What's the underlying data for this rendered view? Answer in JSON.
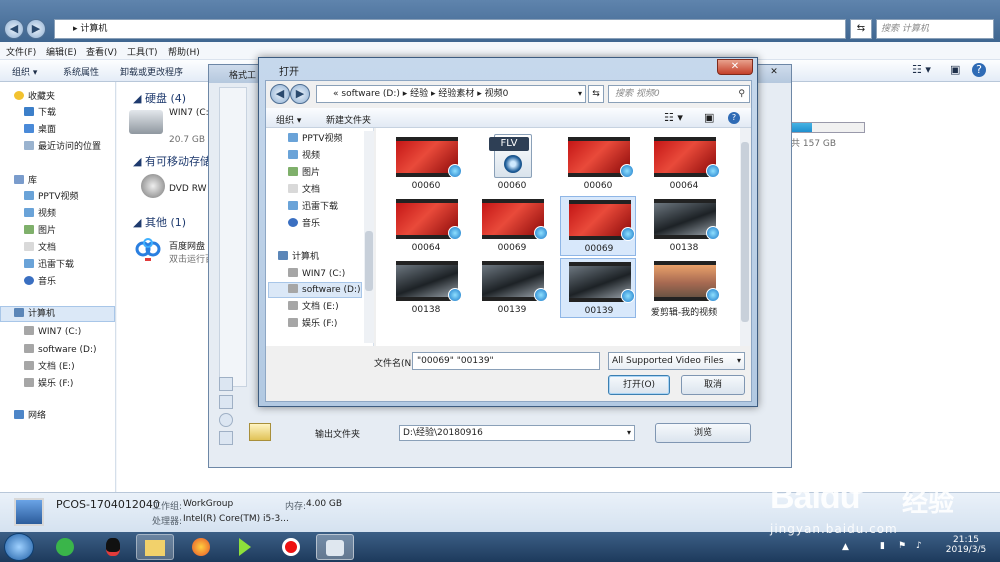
{
  "explorer": {
    "address": "计算机",
    "search_placeholder": "搜索 计算机",
    "menu": [
      "文件(F)",
      "编辑(E)",
      "查看(V)",
      "工具(T)",
      "帮助(H)"
    ],
    "toolbar": [
      "组织",
      "系统属性",
      "卸载或更改程序"
    ],
    "nav": {
      "favorites": "收藏夹",
      "fav_items": [
        "下载",
        "桌面",
        "最近访问的位置"
      ],
      "libraries": "库",
      "lib_items": [
        "PPTV视频",
        "视频",
        "图片",
        "文档",
        "迅雷下载",
        "音乐"
      ],
      "computer": "计算机",
      "drives": [
        "WIN7 (C:)",
        "software (D:)",
        "文档 (E:)",
        "娱乐 (F:)"
      ],
      "network": "网络"
    },
    "groups": {
      "hdd": "硬盘 (4)",
      "removable": "有可移动存储的",
      "other": "其他 (1)"
    },
    "items": {
      "win7": "WIN7 (C:)",
      "win7_free": "20.7 GB",
      "dvd": "DVD RW",
      "baidu": "百度网盘",
      "baidu_sub": "双击运行百",
      "right_size": "共 157 GB"
    },
    "details": {
      "pc_name": "PCOS-1704012040",
      "workgroup_lbl": "工作组:",
      "workgroup": "WorkGroup",
      "memory_lbl": "内存:",
      "memory": "4.00 GB",
      "cpu_lbl": "处理器:",
      "cpu": "Intel(R) Core(TM) i5-3..."
    }
  },
  "ff_window": {
    "title": "格式工",
    "output_label": "输出文件夹",
    "output_path": "D:\\经验\\20180916",
    "browse": "浏览"
  },
  "dialog": {
    "title": "打开",
    "close": "✕",
    "address": [
      "software (D:)",
      "经验",
      "经验素材",
      "视频0"
    ],
    "search_placeholder": "搜索 视频0",
    "organize": "组织",
    "new_folder": "新建文件夹",
    "nav_items": [
      "PPTV视频",
      "视频",
      "图片",
      "文档",
      "迅雷下载",
      "音乐"
    ],
    "nav_computer": "计算机",
    "nav_drives": [
      "WIN7 (C:)",
      "software (D:)",
      "文档 (E:)",
      "娱乐 (F:)"
    ],
    "files": [
      {
        "name": "00060",
        "kind": "red",
        "selected": false
      },
      {
        "name": "00060",
        "kind": "flv",
        "selected": false
      },
      {
        "name": "00060",
        "kind": "red",
        "selected": false
      },
      {
        "name": "00064",
        "kind": "red",
        "selected": false
      },
      {
        "name": "00064",
        "kind": "red",
        "selected": false
      },
      {
        "name": "00069",
        "kind": "red",
        "selected": false
      },
      {
        "name": "00069",
        "kind": "red",
        "selected": true
      },
      {
        "name": "00138",
        "kind": "car",
        "selected": false
      },
      {
        "name": "00138",
        "kind": "car",
        "selected": false
      },
      {
        "name": "00139",
        "kind": "car",
        "selected": false
      },
      {
        "name": "00139",
        "kind": "car",
        "selected": true
      },
      {
        "name": "爱剪辑-我的视频",
        "kind": "sky",
        "selected": false
      }
    ],
    "flv_label": "FLV",
    "filename_label": "文件名(N):",
    "filename_value": "\"00069\" \"00139\"",
    "filetype": "All Supported Video Files",
    "open": "打开(O)",
    "cancel": "取消"
  },
  "taskbar": {
    "time": "21:15",
    "date": "2019/3/5"
  },
  "watermark": {
    "brand": "Bai",
    "brand2": "du",
    "brand_cn": "经验",
    "url": "jingyan.baidu.com"
  }
}
